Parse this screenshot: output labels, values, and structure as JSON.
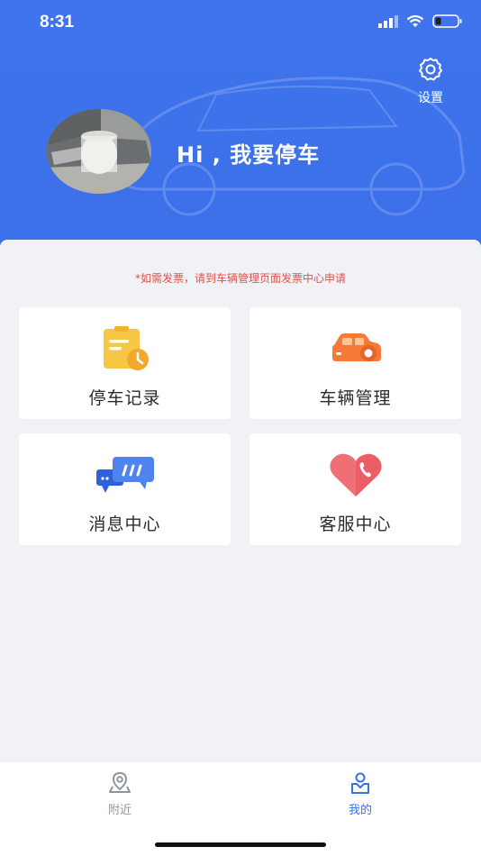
{
  "status_bar": {
    "time": "8:31"
  },
  "header": {
    "settings_label": "设置",
    "greeting": "Hi , 我要停车"
  },
  "notice": "*如需发票，请到车辆管理页面发票中心申请",
  "cards": [
    {
      "label": "停车记录",
      "icon": "parking-record-icon"
    },
    {
      "label": "车辆管理",
      "icon": "car-management-icon"
    },
    {
      "label": "消息中心",
      "icon": "message-center-icon"
    },
    {
      "label": "客服中心",
      "icon": "customer-service-icon"
    }
  ],
  "tabbar": {
    "items": [
      {
        "label": "附近",
        "icon": "map-pin-icon"
      },
      {
        "label": "我的",
        "icon": "user-icon"
      }
    ],
    "active": "我的"
  },
  "colors": {
    "header_blue": "#3f74ec",
    "notice_red": "#e0524a",
    "active_tab": "#3a6fe8",
    "inactive_tab": "#8f959e",
    "icon_yellow": "#f6c743",
    "icon_orange": "#f47a35",
    "icon_blue": "#3f74ec",
    "icon_pink": "#ec5e65"
  }
}
